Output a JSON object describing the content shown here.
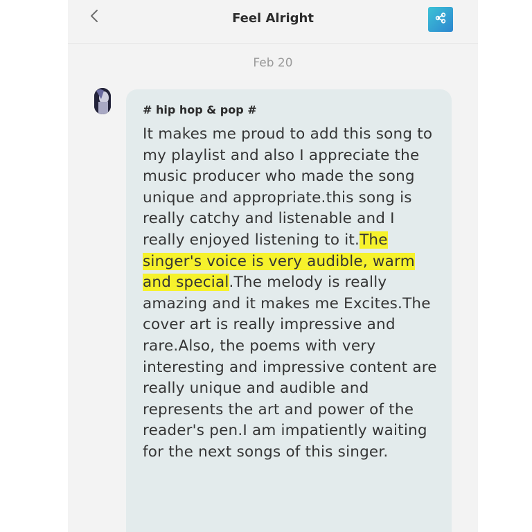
{
  "header": {
    "title": "Feel Alright",
    "back_icon": "chevron-left-icon",
    "share_icon": "share-icon"
  },
  "message": {
    "date": "Feb 20",
    "tag": "# hip hop & pop #",
    "text_before": "It makes me proud to add this song to my playlist and also I appreciate the music producer who made the song unique and appropriate.this song is really catchy and listenable and I really enjoyed listening to it.",
    "text_highlight": "The singer's voice is very audible, warm and special",
    "text_after": ".The melody is really amazing and it makes me Excites.The cover art is really impressive and rare.Also, the poems with very interesting and impressive content are really unique and audible and represents the art and power of the reader's pen.I am impatiently waiting for the next songs of this singer."
  },
  "colors": {
    "highlight": "#f6f22c",
    "bubble": "#e3ebec",
    "share_button": "#2d9fd3"
  }
}
